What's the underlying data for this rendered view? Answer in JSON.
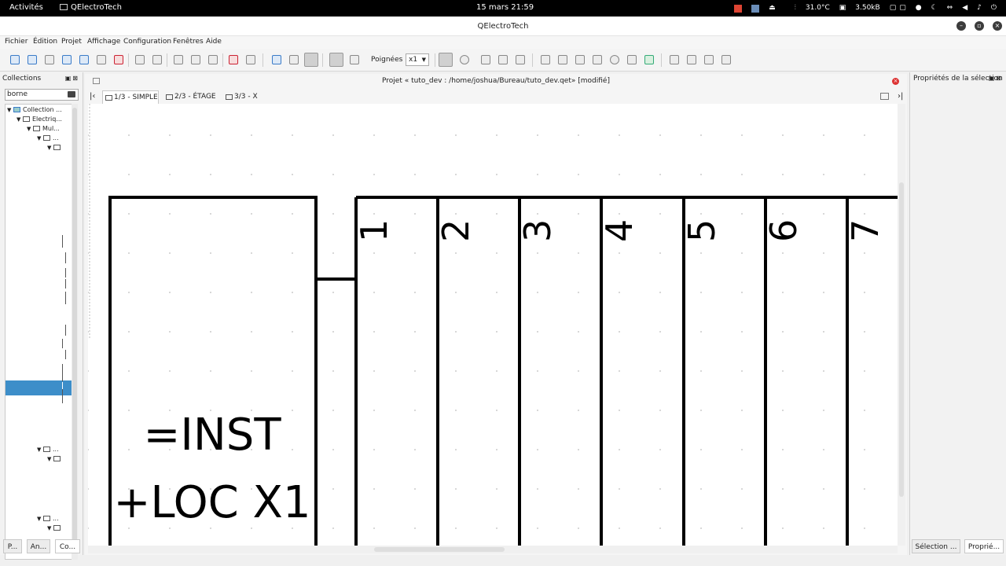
{
  "topbar": {
    "activities": "Activités",
    "app_name": "QElectroTech",
    "clock": "15 mars  21:59",
    "temperature": "31.0°C",
    "network_speed": "3.50kB"
  },
  "window": {
    "title": "QElectroTech"
  },
  "menu": [
    "Fichier",
    "Édition",
    "Projet",
    "Affichage",
    "Configuration",
    "Fenêtres",
    "Aide"
  ],
  "toolbar": {
    "handles_label": "Poignées :",
    "handles_value": "x1"
  },
  "collections": {
    "title": "Collections",
    "search_value": "borne",
    "tree": [
      {
        "label": "Collection ...",
        "level": 0
      },
      {
        "label": "Electriq...",
        "level": 1
      },
      {
        "label": "Mul...",
        "level": 2
      },
      {
        "label": "...",
        "level": 3
      },
      {
        "label": "",
        "level": 4
      },
      {
        "label": "...",
        "level": 3
      },
      {
        "label": "",
        "level": 4
      },
      {
        "label": "...",
        "level": 3
      },
      {
        "label": "",
        "level": 4
      }
    ],
    "bottom_tabs": [
      "P...",
      "An...",
      "Co..."
    ]
  },
  "project": {
    "title": "Projet « tuto_dev : /home/joshua/Bureau/tuto_dev.qet» [modifié]",
    "tabs": [
      "1/3 - SIMPLE",
      "2/3 - ÉTAGE",
      "3/3 - X"
    ],
    "active_tab": 0
  },
  "diagram": {
    "label_line1": "=INST",
    "label_line2": "+LOC X1",
    "terminals": [
      "1",
      "2",
      "3",
      "4",
      "5",
      "6",
      "7"
    ]
  },
  "properties": {
    "title": "Propriétés de la sélection",
    "bottom_tabs": [
      "Sélection ...",
      "Proprié..."
    ]
  }
}
